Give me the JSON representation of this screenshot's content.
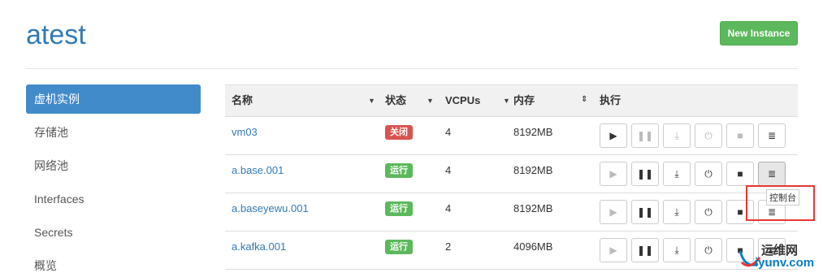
{
  "header": {
    "title": "atest",
    "new_instance_label": "New Instance"
  },
  "sidebar": {
    "items": [
      {
        "label": "虚机实例",
        "active": true
      },
      {
        "label": "存储池"
      },
      {
        "label": "网络池"
      },
      {
        "label": "Interfaces"
      },
      {
        "label": "Secrets"
      },
      {
        "label": "概览"
      }
    ]
  },
  "table": {
    "columns": {
      "name": "名称",
      "status": "状态",
      "vcpus": "VCPUs",
      "memory": "内存",
      "actions": "执行"
    },
    "rows": [
      {
        "name": "vm03",
        "status": "关闭",
        "status_type": "stopped",
        "vcpus": "4",
        "memory": "8192MB"
      },
      {
        "name": "a.base.001",
        "status": "运行",
        "status_type": "running",
        "vcpus": "4",
        "memory": "8192MB"
      },
      {
        "name": "a.baseyewu.001",
        "status": "运行",
        "status_type": "running",
        "vcpus": "4",
        "memory": "8192MB"
      },
      {
        "name": "a.kafka.001",
        "status": "运行",
        "status_type": "running",
        "vcpus": "2",
        "memory": "4096MB"
      }
    ],
    "action_icons": [
      "play-icon",
      "pause-icon",
      "download-icon",
      "power-icon",
      "stop-icon",
      "console-icon"
    ]
  },
  "tooltip": {
    "text": "控制台"
  },
  "watermark": {
    "top": "运维网",
    "bottom": "iyunv.com"
  },
  "colors": {
    "accent": "#337ab7",
    "active_nav": "#428bca",
    "success": "#5cb85c",
    "danger": "#d9534f",
    "highlight": "#e53935"
  }
}
